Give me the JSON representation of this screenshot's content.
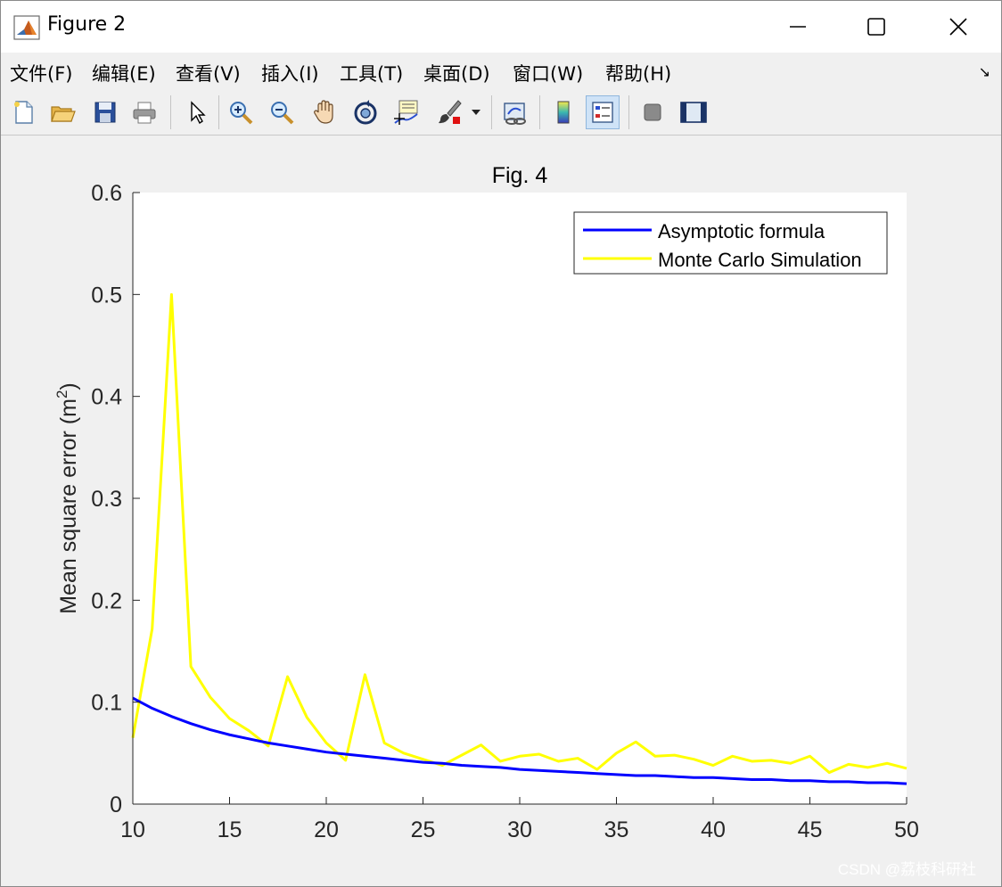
{
  "window": {
    "title": "Figure 2",
    "minimize_icon": "minimize-icon",
    "maximize_icon": "maximize-icon",
    "close_icon": "close-icon"
  },
  "menu": [
    {
      "label": "文件(F)"
    },
    {
      "label": "编辑(E)"
    },
    {
      "label": "查看(V)"
    },
    {
      "label": "插入(I)"
    },
    {
      "label": "工具(T)"
    },
    {
      "label": "桌面(D)"
    },
    {
      "label": "窗口(W)"
    },
    {
      "label": "帮助(H)"
    }
  ],
  "toolbar": {
    "icons": [
      "new-figure-icon",
      "open-file-icon",
      "save-icon",
      "print-icon",
      "edit-plot-icon",
      "zoom-in-icon",
      "zoom-out-icon",
      "pan-icon",
      "rotate-3d-icon",
      "data-cursor-icon",
      "brush-icon",
      "link-plot-icon",
      "colorbar-icon",
      "legend-icon",
      "hide-plot-tools-icon",
      "show-plot-tools-icon"
    ],
    "active": "legend-icon"
  },
  "colors": {
    "asymptotic": "#0000ff",
    "monte_carlo": "#ffff00",
    "axes_bg": "#ffffff",
    "figure_bg": "#f0f0f0"
  },
  "chart_data": {
    "type": "line",
    "title": "Fig. 4",
    "xlabel": "",
    "ylabel": "Mean square error (m",
    "ylabel_sup": "2",
    "ylabel_end": ")",
    "xlim": [
      10,
      50
    ],
    "ylim": [
      0,
      0.6
    ],
    "xticks": [
      "10",
      "15",
      "20",
      "25",
      "30",
      "35",
      "40",
      "45",
      "50"
    ],
    "yticks": [
      "0",
      "0.1",
      "0.2",
      "0.3",
      "0.4",
      "0.5",
      "0.6"
    ],
    "legend_position": "top-right",
    "grid": false,
    "x": [
      10,
      11,
      12,
      13,
      14,
      15,
      16,
      17,
      18,
      19,
      20,
      21,
      22,
      23,
      24,
      25,
      26,
      27,
      28,
      29,
      30,
      31,
      32,
      33,
      34,
      35,
      36,
      37,
      38,
      39,
      40,
      41,
      42,
      43,
      44,
      45,
      46,
      47,
      48,
      49,
      50
    ],
    "series": [
      {
        "name": "Asymptotic formula",
        "color": "#0000ff",
        "values": [
          0.104,
          0.094,
          0.086,
          0.079,
          0.073,
          0.068,
          0.064,
          0.06,
          0.057,
          0.054,
          0.051,
          0.049,
          0.047,
          0.045,
          0.043,
          0.041,
          0.04,
          0.038,
          0.037,
          0.036,
          0.034,
          0.033,
          0.032,
          0.031,
          0.03,
          0.029,
          0.028,
          0.028,
          0.027,
          0.026,
          0.026,
          0.025,
          0.024,
          0.024,
          0.023,
          0.023,
          0.022,
          0.022,
          0.021,
          0.021,
          0.02
        ]
      },
      {
        "name": "Monte Carlo Simulation",
        "color": "#ffff00",
        "values": [
          0.065,
          0.172,
          0.5,
          0.135,
          0.105,
          0.084,
          0.072,
          0.057,
          0.125,
          0.085,
          0.06,
          0.043,
          0.127,
          0.06,
          0.05,
          0.044,
          0.038,
          0.048,
          0.058,
          0.042,
          0.047,
          0.049,
          0.042,
          0.045,
          0.034,
          0.05,
          0.061,
          0.047,
          0.048,
          0.044,
          0.038,
          0.047,
          0.042,
          0.043,
          0.04,
          0.047,
          0.031,
          0.039,
          0.036,
          0.04,
          0.035
        ]
      }
    ]
  },
  "watermark": "CSDN @荔枝科研社"
}
